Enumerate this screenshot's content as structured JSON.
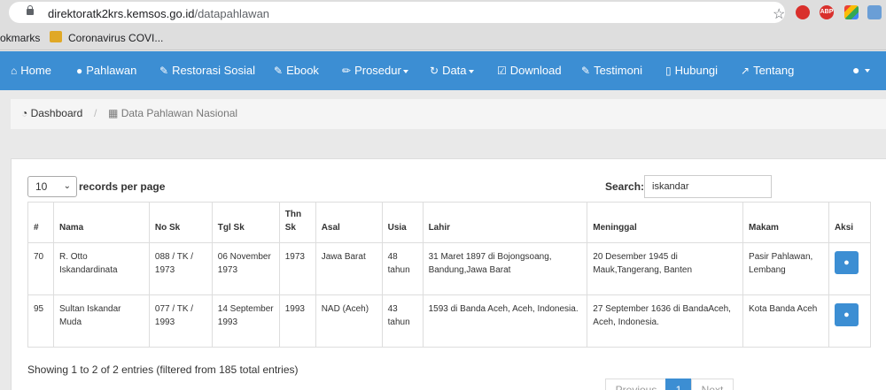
{
  "browser": {
    "url_host": "direktoratk2krs.kemsos.go.id",
    "url_path": "/datapahlawan",
    "bookmarks": [
      "okmarks",
      "Coronavirus COVI..."
    ],
    "extensions": [
      "ABP"
    ]
  },
  "nav": {
    "items": [
      {
        "label": "Home",
        "icon": "home-icon"
      },
      {
        "label": "Pahlawan",
        "icon": "user-icon"
      },
      {
        "label": "Restorasi Sosial",
        "icon": "edit-icon"
      },
      {
        "label": "Ebook",
        "icon": "edit-icon"
      },
      {
        "label": "Prosedur",
        "icon": "pencil-icon",
        "dropdown": true
      },
      {
        "label": "Data",
        "icon": "refresh-icon",
        "dropdown": true
      },
      {
        "label": "Download",
        "icon": "check-icon"
      },
      {
        "label": "Testimoni",
        "icon": "edit-icon"
      },
      {
        "label": "Hubungi",
        "icon": "phone-icon"
      },
      {
        "label": "Tentang",
        "icon": "share-icon"
      }
    ],
    "accent": "#3c8ed3"
  },
  "breadcrumb": {
    "home": "Dashboard",
    "current": "Data Pahlawan Nasional"
  },
  "table_controls": {
    "page_length": "10",
    "length_label": "records per page",
    "search_label": "Search:",
    "search_value": "iskandar"
  },
  "table": {
    "headers": [
      "#",
      "Nama",
      "No Sk",
      "Tgl Sk",
      "Thn Sk",
      "Asal",
      "Usia",
      "Lahir",
      "Meninggal",
      "Makam",
      "Aksi"
    ],
    "rows": [
      {
        "no": "70",
        "nama": "R. Otto Iskandardinata",
        "no_sk": "088 / TK / 1973",
        "tgl_sk": "06 November 1973",
        "thn_sk": "1973",
        "asal": "Jawa Barat",
        "usia": "48 tahun",
        "lahir": "31 Maret 1897 di Bojongsoang, Bandung,Jawa Barat",
        "meninggal": "20 Desember 1945 di Mauk,Tangerang, Banten",
        "makam": "Pasir Pahlawan, Lembang"
      },
      {
        "no": "95",
        "nama": "Sultan Iskandar Muda",
        "no_sk": "077 / TK / 1993",
        "tgl_sk": "14 September 1993",
        "thn_sk": "1993",
        "asal": "NAD (Aceh)",
        "usia": "43 tahun",
        "lahir": "1593 di Banda Aceh, Aceh, Indonesia.",
        "meninggal": "27 September 1636 di BandaAceh, Aceh, Indonesia.",
        "makam": "Kota Banda Aceh"
      }
    ]
  },
  "footer": {
    "info": "Showing 1 to 2 of 2 entries (filtered from 185 total entries)",
    "pagination": [
      "Previous",
      "1",
      "Next"
    ]
  }
}
